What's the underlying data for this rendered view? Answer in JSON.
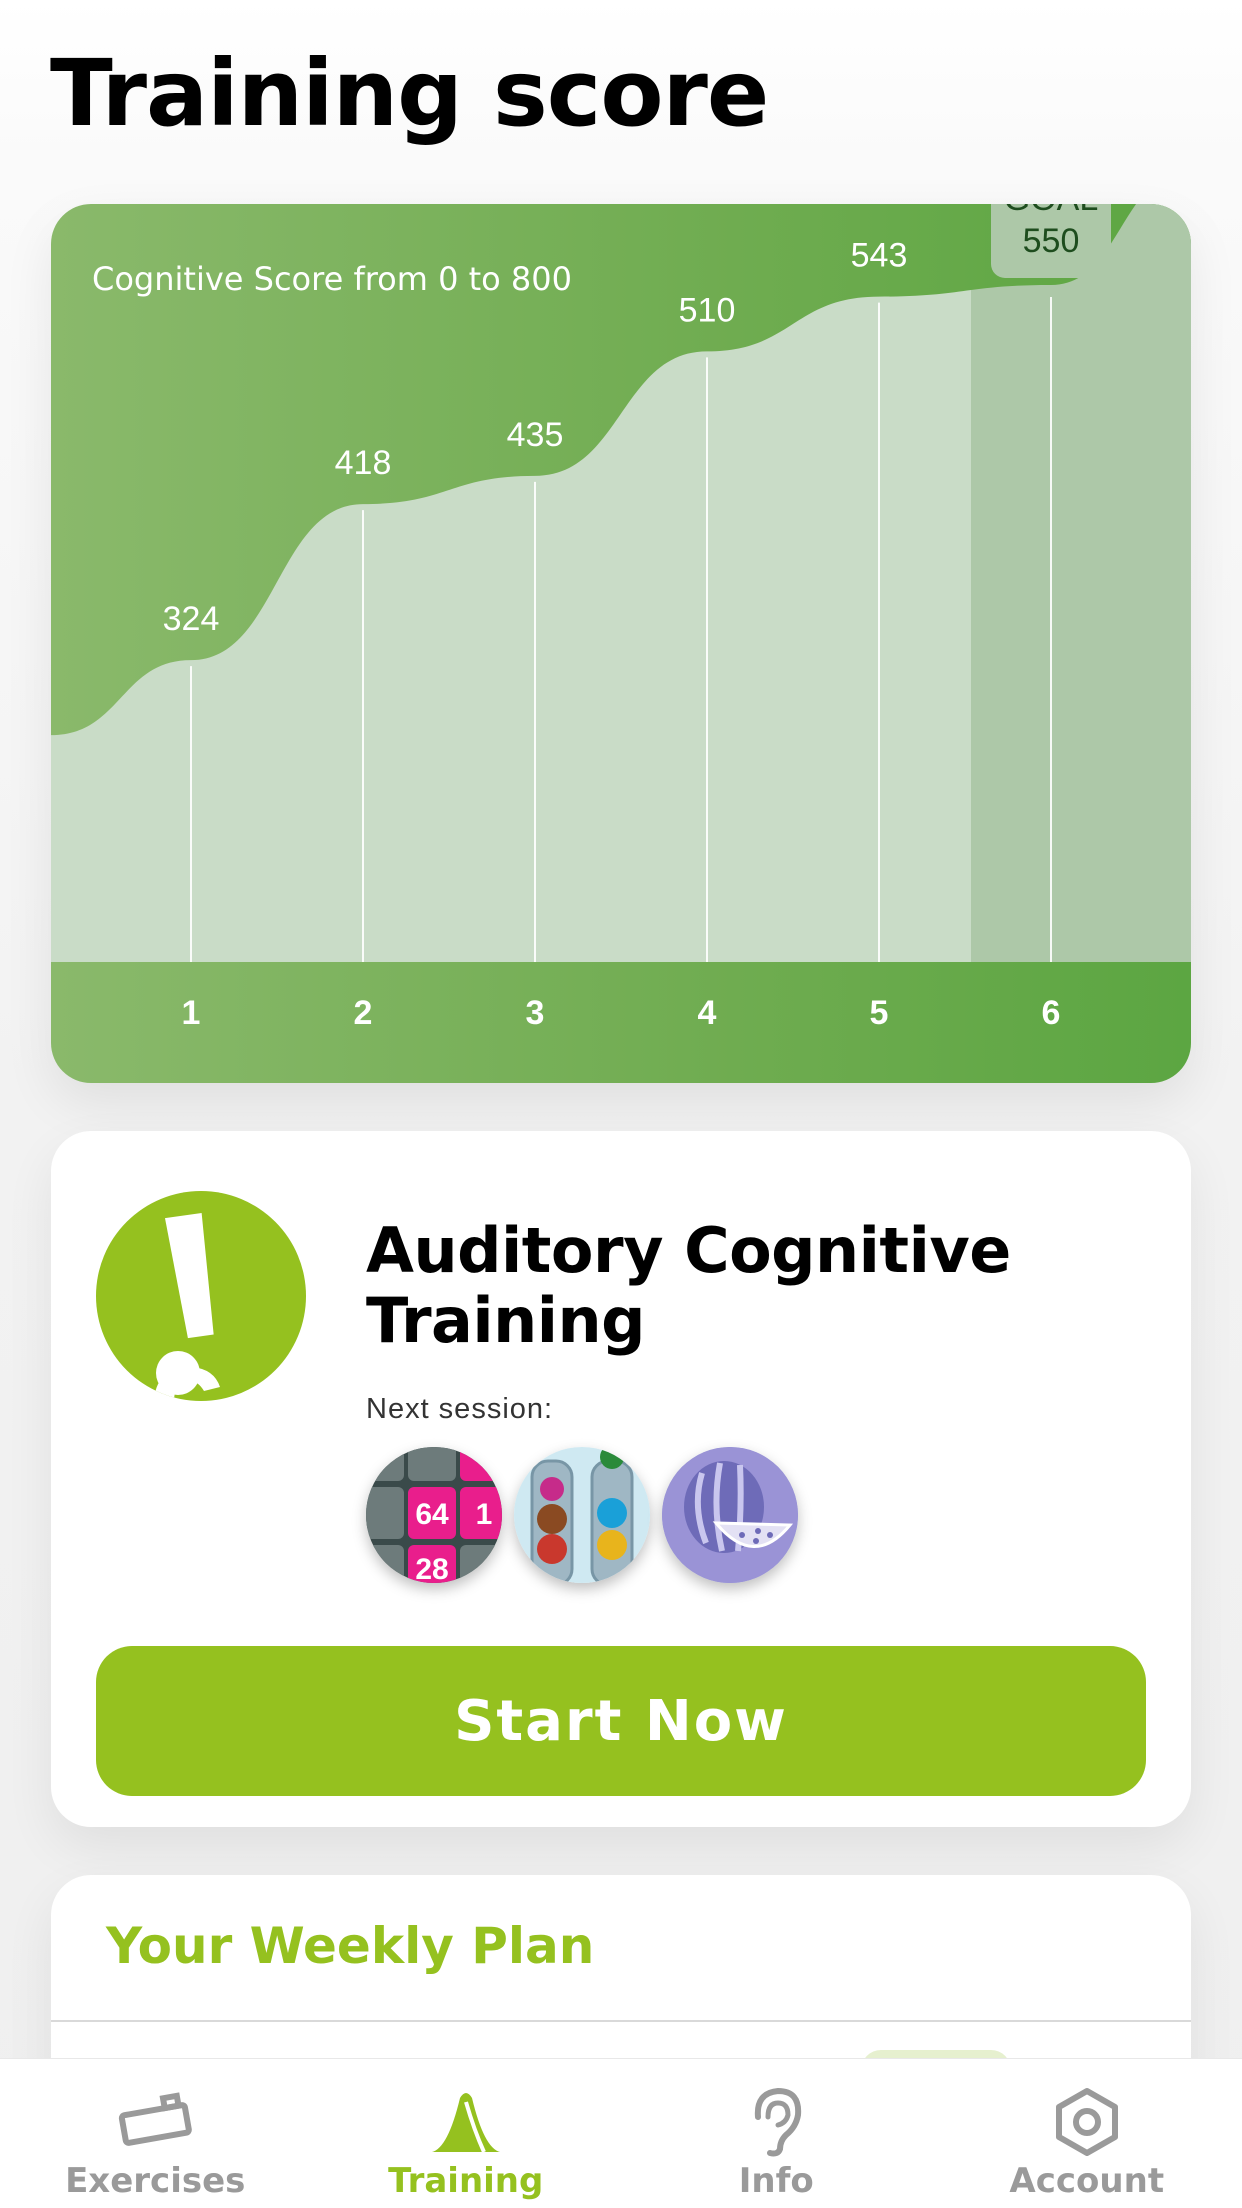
{
  "page": {
    "title": "Training score"
  },
  "chart_data": {
    "type": "area",
    "title": "Cognitive Score from 0 to 800",
    "categories": [
      "1",
      "2",
      "3",
      "4",
      "5",
      "6"
    ],
    "values": [
      324,
      418,
      435,
      510,
      543,
      550
    ],
    "value_labels": [
      "324",
      "418",
      "435",
      "510",
      "543"
    ],
    "goal": {
      "label": "GOAL",
      "value": "550",
      "category": "6"
    },
    "ylim": [
      0,
      800
    ],
    "colors": {
      "card": "#6fac50",
      "fill": "#c9dcc7",
      "goal_fill": "#adc8a8",
      "goal_badge": "#adc8a8",
      "goal_text": "#1e4d1e",
      "text": "#ffffff"
    }
  },
  "program": {
    "title": "Auditory Cognitive Training",
    "next_session_label": "Next session:",
    "sessions": [
      {
        "icon": "number-tiles-game-icon"
      },
      {
        "icon": "ball-tubes-game-icon"
      },
      {
        "icon": "watermelon-game-icon"
      }
    ],
    "tile_values": [
      "64",
      "1",
      "28"
    ],
    "start_label": "Start Now",
    "accent": "#95c11f"
  },
  "weekly": {
    "title": "Your Weekly Plan"
  },
  "tabs": [
    {
      "label": "Exercises",
      "icon": "exercises-icon",
      "active": false
    },
    {
      "label": "Training",
      "icon": "training-icon",
      "active": true
    },
    {
      "label": "Info",
      "icon": "ear-icon",
      "active": false
    },
    {
      "label": "Account",
      "icon": "hexagon-settings-icon",
      "active": false
    }
  ],
  "tab_colors": {
    "active": "#95c11f",
    "inactive": "#9a9a9a"
  }
}
